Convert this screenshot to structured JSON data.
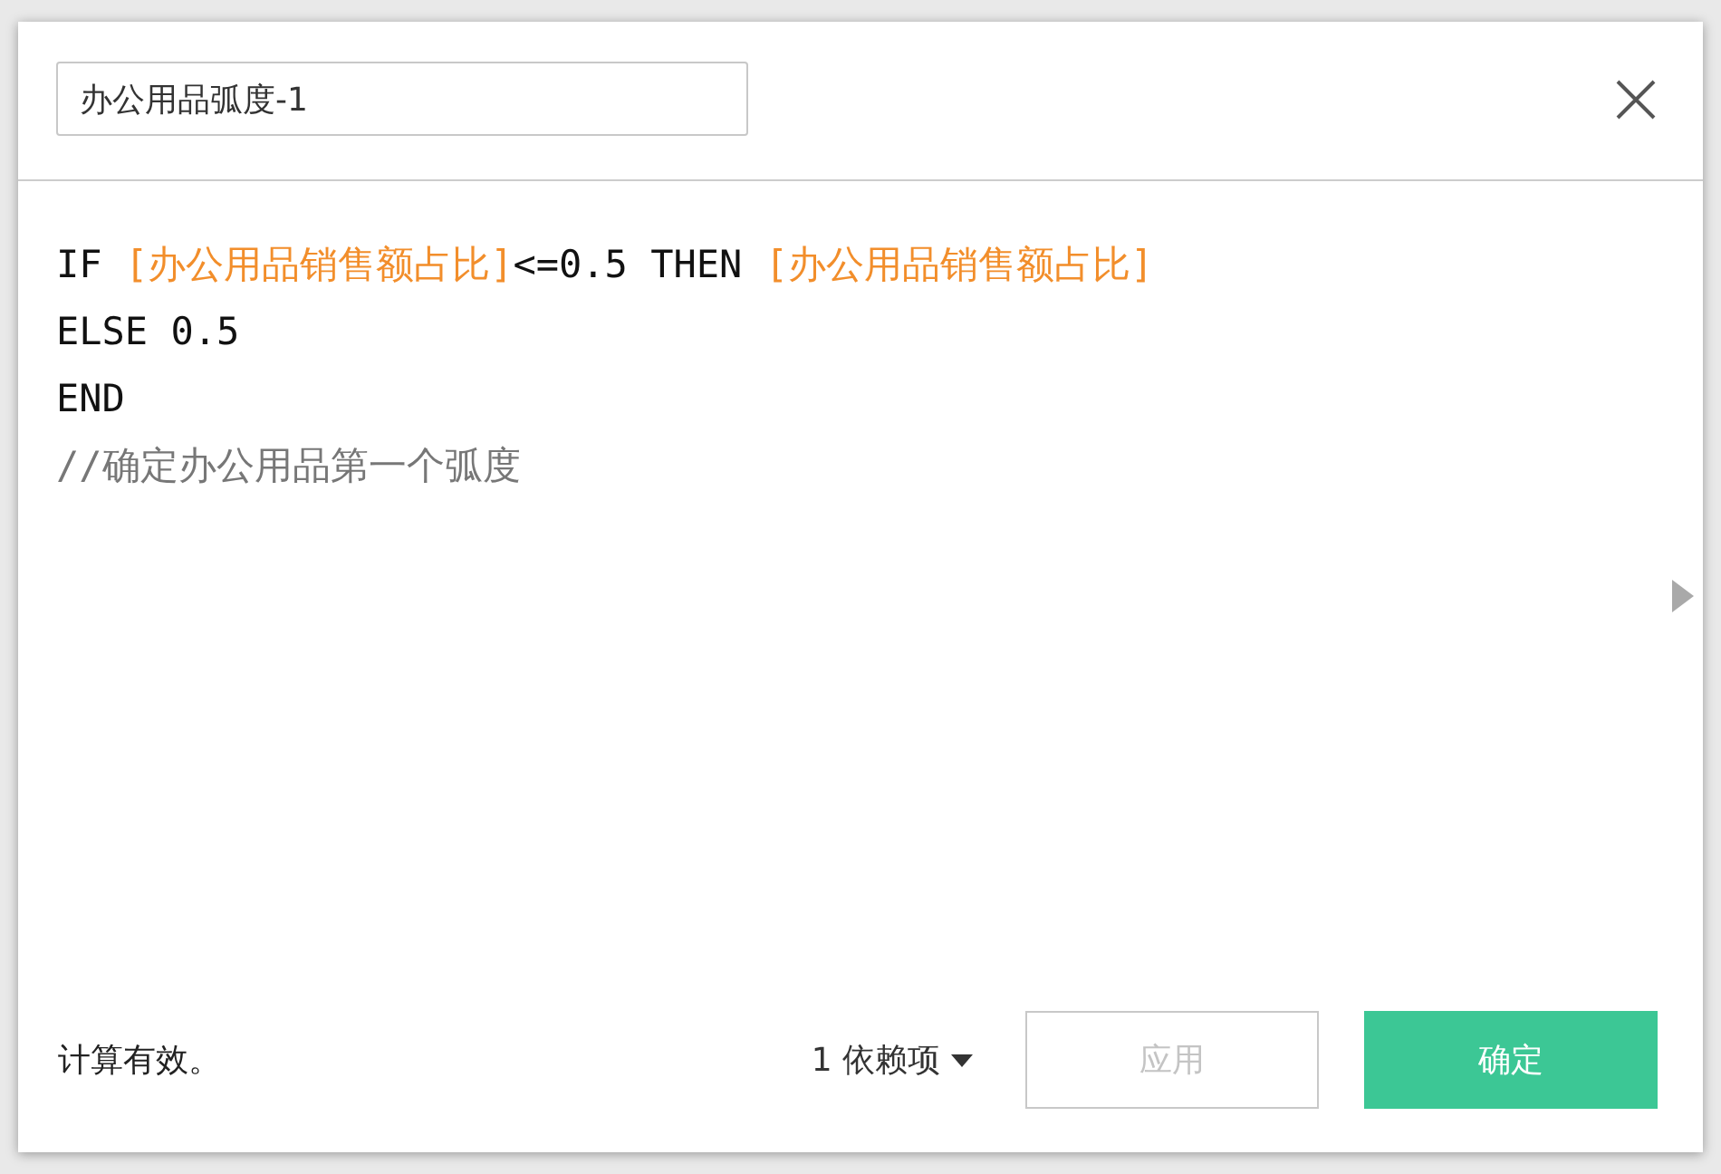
{
  "calculation_name": {
    "value": "办公用品弧度-1"
  },
  "formula": [
    [
      {
        "kind": "keyword",
        "text": "IF "
      },
      {
        "kind": "field",
        "text": "[办公用品销售额占比]"
      },
      {
        "kind": "keyword",
        "text": "<=0.5 THEN "
      },
      {
        "kind": "field",
        "text": "[办公用品销售额占比]"
      }
    ],
    [
      {
        "kind": "keyword",
        "text": "ELSE 0.5"
      }
    ],
    [
      {
        "kind": "keyword",
        "text": "END"
      }
    ],
    [
      {
        "kind": "comment",
        "text": "//确定办公用品第一个弧度"
      }
    ]
  ],
  "status": "计算有效。",
  "dependencies": "1 依赖项",
  "buttons": [
    {
      "label": "应用",
      "kind": "secondary",
      "disabled": true
    },
    {
      "label": "确定",
      "kind": "primary",
      "disabled": false
    }
  ]
}
